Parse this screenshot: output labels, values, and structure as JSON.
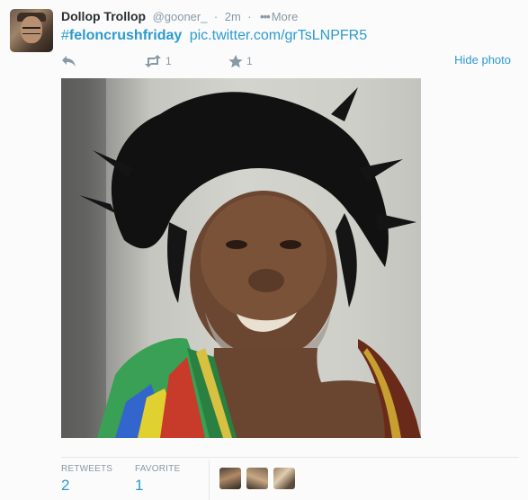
{
  "tweet": {
    "fullname": "Dollop Trollop",
    "username": "@gooner_",
    "separator": "·",
    "time": "2m",
    "more_label": "More",
    "more_dots": "•••",
    "hashtag_symbol": "#",
    "hashtag_text": "feloncrushfriday",
    "link": "pic.twitter.com/grTsLNPFR5"
  },
  "actions": {
    "reply_icon": "reply-arrow-icon",
    "retweet_icon": "retweet-icon",
    "retweet_count": "1",
    "favorite_icon": "star-icon",
    "favorite_count": "1",
    "hide_photo_label": "Hide photo"
  },
  "stats": {
    "retweets_label": "RETWEETS",
    "retweets_value": "2",
    "favorites_label": "FAVORITE",
    "favorites_value": "1"
  },
  "colors": {
    "link": "#2b9bcf",
    "muted": "#8899a6",
    "text": "#292f33",
    "background": "#fbfbfb"
  }
}
